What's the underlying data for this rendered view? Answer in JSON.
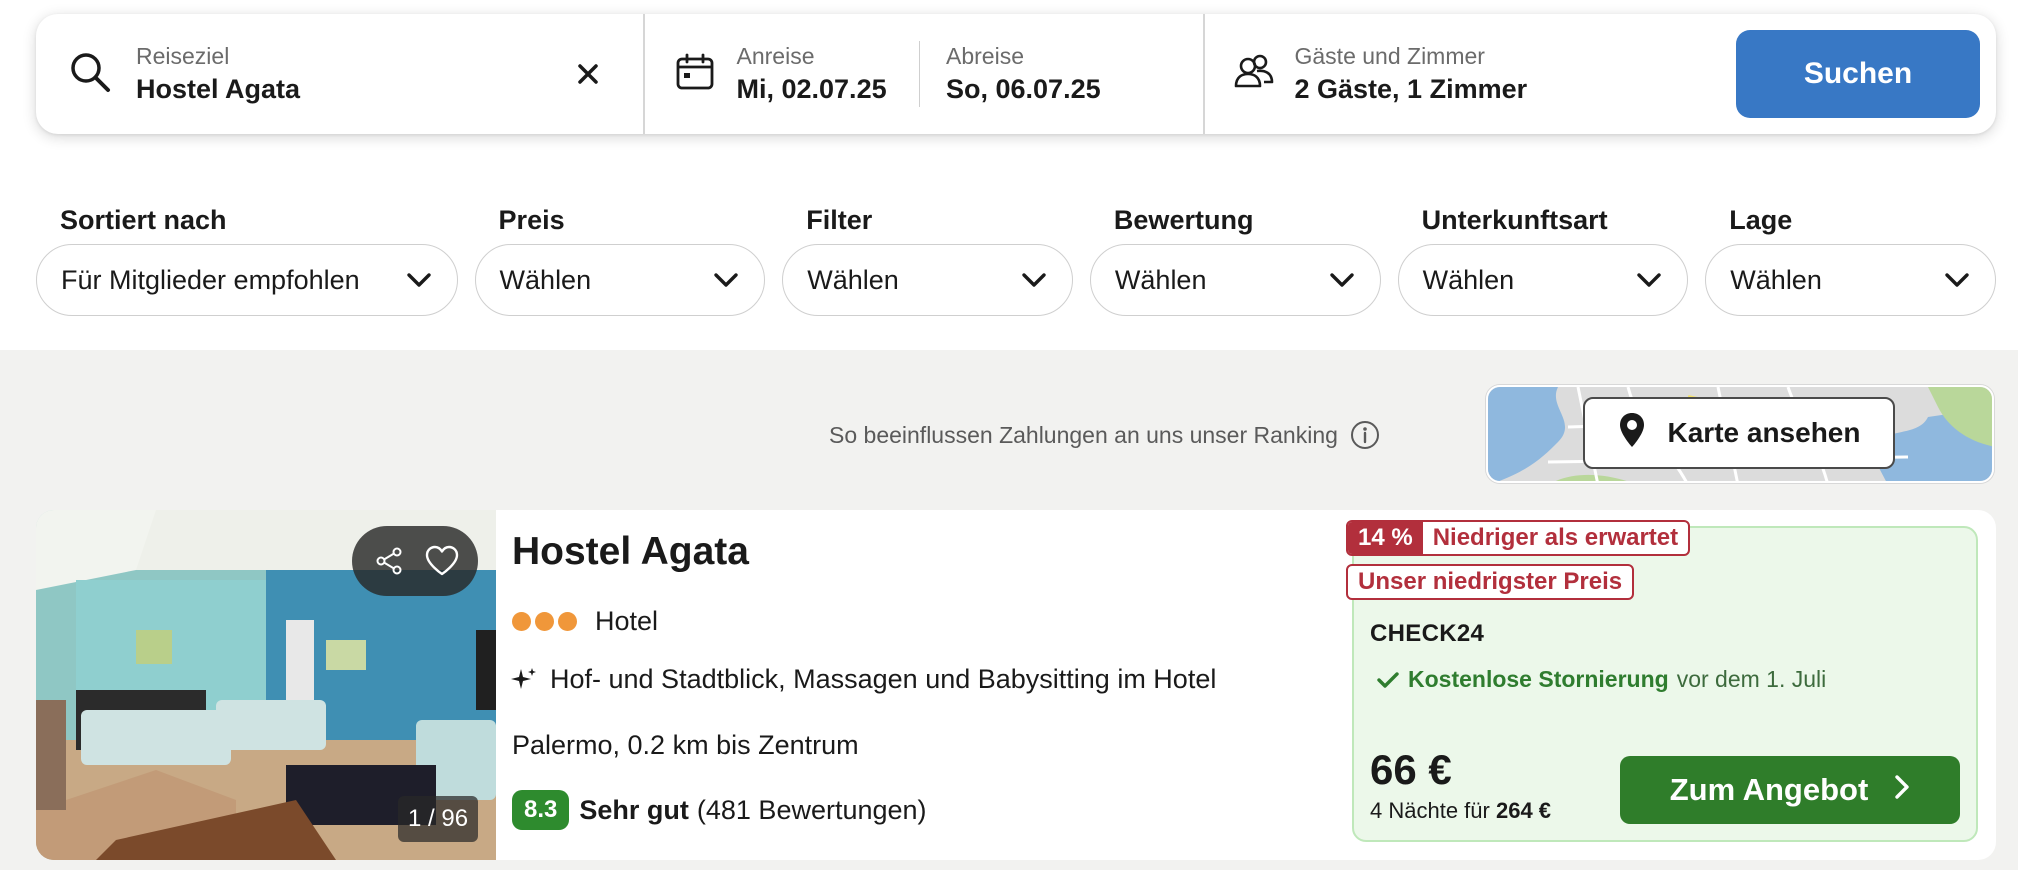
{
  "search": {
    "destination_label": "Reiseziel",
    "destination_value": "Hostel Agata",
    "checkin_label": "Anreise",
    "checkin_value": "Mi, 02.07.25",
    "checkout_label": "Abreise",
    "checkout_value": "So, 06.07.25",
    "guests_label": "Gäste und Zimmer",
    "guests_value": "2 Gäste, 1 Zimmer",
    "search_button": "Suchen",
    "accent_color": "#3878c5"
  },
  "filters": [
    {
      "label": "Sortiert nach",
      "value": "Für Mitglieder empfohlen"
    },
    {
      "label": "Preis",
      "value": "Wählen"
    },
    {
      "label": "Filter",
      "value": "Wählen"
    },
    {
      "label": "Bewertung",
      "value": "Wählen"
    },
    {
      "label": "Unterkunftsart",
      "value": "Wählen"
    },
    {
      "label": "Lage",
      "value": "Wählen"
    }
  ],
  "ranking_note": "So beeinflussen Zahlungen an uns unser Ranking",
  "map_button": "Karte ansehen",
  "listing": {
    "name": "Hostel Agata",
    "type": "Hotel",
    "star_dots": 3,
    "amenities": "Hof- und Stadtblick, Massagen und Babysitting im Hotel",
    "location": "Palermo, 0.2 km bis Zentrum",
    "score": "8.3",
    "score_word": "Sehr gut",
    "reviews": "(481 Bewertungen)",
    "photo_counter": "1 / 96",
    "discount_pct": "14 %",
    "discount_text": "Niedriger als erwartet",
    "lowest_price_badge": "Unser niedrigster Preis",
    "provider": "CHECK24",
    "cancel_strong": "Kostenlose Stornierung",
    "cancel_rest": "vor dem 1. Juli",
    "price": "66 €",
    "price_sub_prefix": "4 Nächte für",
    "price_sub_total": "264 €",
    "offer_button": "Zum Angebot",
    "score_color": "#2e8b2e",
    "badge_color": "#b22f3c"
  }
}
